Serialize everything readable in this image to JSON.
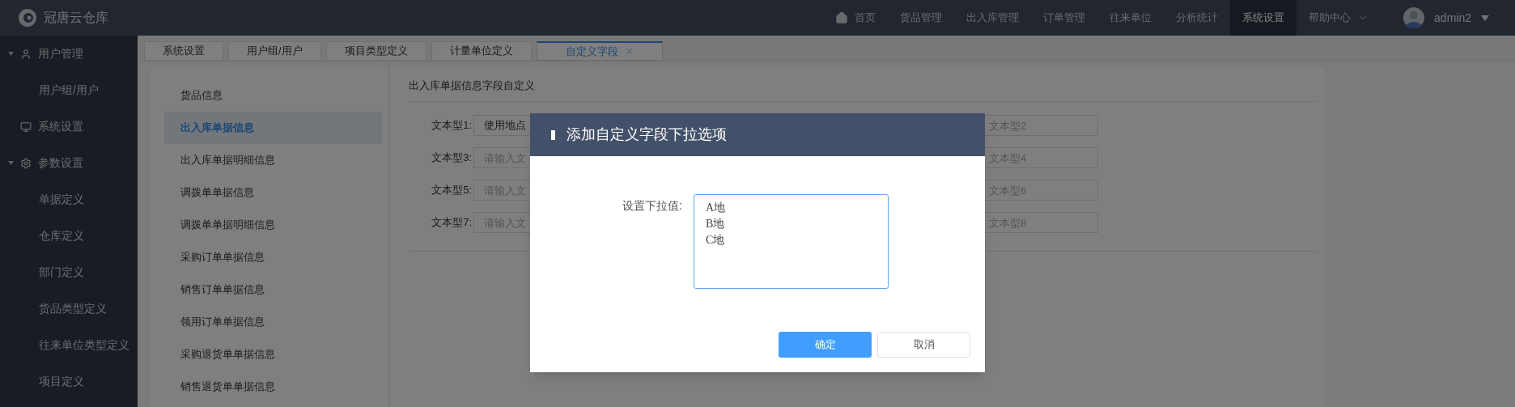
{
  "brand": {
    "name": "冠唐云仓库"
  },
  "top_nav": [
    {
      "label": "首页",
      "kind": "home",
      "selected": false
    },
    {
      "label": "货品管理",
      "kind": "plain",
      "selected": false
    },
    {
      "label": "出入库管理",
      "kind": "plain",
      "selected": false
    },
    {
      "label": "订单管理",
      "kind": "plain",
      "selected": false
    },
    {
      "label": "往来单位",
      "kind": "plain",
      "selected": false
    },
    {
      "label": "分析统计",
      "kind": "plain",
      "selected": false
    },
    {
      "label": "系统设置",
      "kind": "plain",
      "selected": true
    },
    {
      "label": "帮助中心",
      "kind": "dropdown",
      "selected": false
    }
  ],
  "user": {
    "name": "admin2"
  },
  "sidebar": {
    "items": [
      {
        "label": "用户管理",
        "expanded": true,
        "children": [
          {
            "label": "用户组/用户"
          }
        ]
      },
      {
        "label": "系统设置"
      },
      {
        "label": "参数设置",
        "expanded": true,
        "children": [
          {
            "label": "单据定义"
          },
          {
            "label": "仓库定义"
          },
          {
            "label": "部门定义"
          },
          {
            "label": "货品类型定义"
          },
          {
            "label": "往来单位类型定义"
          },
          {
            "label": "项目定义"
          }
        ]
      }
    ]
  },
  "tabs": [
    {
      "label": "系统设置",
      "selected": false,
      "closable": false
    },
    {
      "label": "用户组/用户",
      "selected": false,
      "closable": false
    },
    {
      "label": "项目类型定义",
      "selected": false,
      "closable": false
    },
    {
      "label": "计量单位定义",
      "selected": false,
      "closable": false
    },
    {
      "label": "自定义字段",
      "selected": true,
      "closable": true
    }
  ],
  "sub_menu": [
    {
      "label": "货品信息",
      "selected": false
    },
    {
      "label": "出入库单据信息",
      "selected": true
    },
    {
      "label": "出入库单据明细信息",
      "selected": false
    },
    {
      "label": "调拨单单据信息",
      "selected": false
    },
    {
      "label": "调拨单单据明细信息",
      "selected": false
    },
    {
      "label": "采购订单单据信息",
      "selected": false
    },
    {
      "label": "销售订单单据信息",
      "selected": false
    },
    {
      "label": "领用订单单据信息",
      "selected": false
    },
    {
      "label": "采购退货单单据信息",
      "selected": false
    },
    {
      "label": "销售退货单单据信息",
      "selected": false
    }
  ],
  "form": {
    "title": "出入库单据信息字段自定义",
    "rows": [
      {
        "label": "文本型1:",
        "value": "使用地点",
        "right_placeholder": "文本型2"
      },
      {
        "label": "文本型3:",
        "placeholder": "请输入文",
        "right_placeholder": "文本型4"
      },
      {
        "label": "文本型5:",
        "placeholder": "请输入文",
        "right_placeholder": "文本型6"
      },
      {
        "label": "文本型7:",
        "placeholder": "请输入文",
        "right_placeholder": "文本型8"
      }
    ]
  },
  "dialog": {
    "title": "添加自定义字段下拉选项",
    "field_label": "设置下拉值:",
    "value": "A地\nB地\nC地",
    "buttons": [
      {
        "label": "确定",
        "kind": "primary"
      },
      {
        "label": "取消",
        "kind": "default"
      }
    ]
  }
}
